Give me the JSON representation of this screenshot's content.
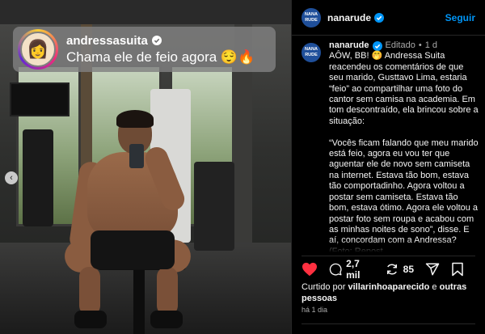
{
  "overlay": {
    "username": "andressasuita",
    "comment": "Chama ele de feio agora 😌🔥"
  },
  "header": {
    "avatar_text": "NANA RUDE",
    "username": "nanarude",
    "follow_label": "Seguir"
  },
  "caption": {
    "username": "nanarude",
    "edited": "Editado",
    "age": "1 d",
    "text": "AÔW, BB! 🤭 Andressa Suita reacendeu os comentários de que seu marido, Gusttavo Lima, estaria “feio” ao compartilhar uma foto do cantor sem camisa na academia. Em tom descontraído, ela brincou sobre a situação:\n\n“Vocês ficam falando que meu marido está feio, agora eu vou ter que aguentar ele de novo sem camiseta na internet. Estava tão bom, estava tão comportadinho. Agora voltou a postar sem camiseta. Estava tão bom, estava ótimo. Agora ele voltou a postar foto sem roupa e acabou com as minhas noites de sono”, disse. E aí, concordam com a Andressa? (Foto: Repost"
  },
  "actions": {
    "comments_count": "2,7 mil",
    "reposts_count": "85"
  },
  "likes": {
    "prefix": "Curtido por",
    "user": "villarinhoaparecido",
    "conj": "e",
    "others": "outras pessoas"
  },
  "time": "há 1 dia",
  "colors": {
    "like_red": "#ff3040",
    "follow_blue": "#0095f6",
    "verified_blue": "#0095f6"
  }
}
